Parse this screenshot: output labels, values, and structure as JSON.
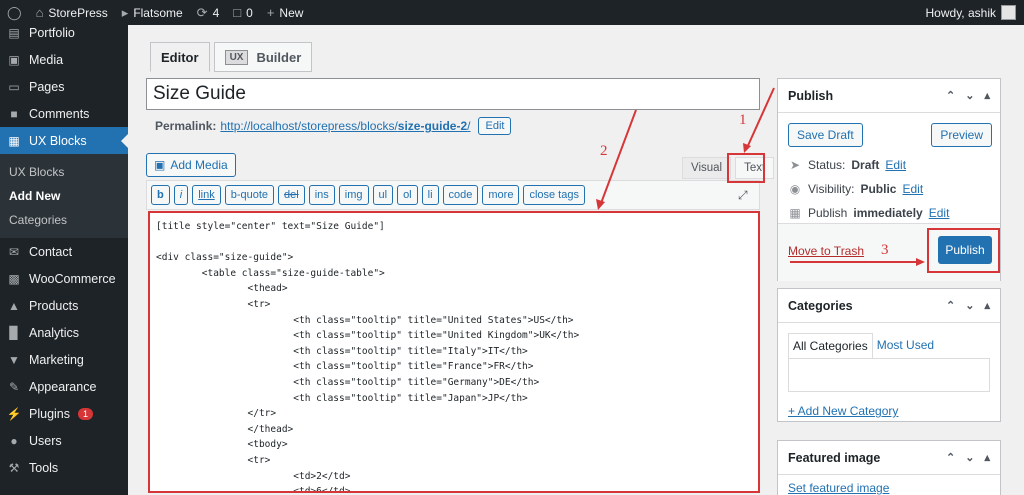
{
  "adminbar": {
    "site_name": "StorePress",
    "theme": "Flatsome",
    "updates": "4",
    "comments": "0",
    "new": "New",
    "howdy": "Howdy, ashik"
  },
  "sidebar": {
    "items": [
      {
        "label": "Portfolio"
      },
      {
        "label": "Media"
      },
      {
        "label": "Pages"
      },
      {
        "label": "Comments"
      },
      {
        "label": "UX Blocks"
      }
    ],
    "submenu": [
      "UX Blocks",
      "Add New",
      "Categories"
    ],
    "items2": [
      {
        "label": "Contact"
      },
      {
        "label": "WooCommerce"
      },
      {
        "label": "Products"
      },
      {
        "label": "Analytics"
      },
      {
        "label": "Marketing"
      },
      {
        "label": "Appearance"
      },
      {
        "label": "Plugins"
      },
      {
        "label": "Users"
      },
      {
        "label": "Tools"
      }
    ],
    "plugins_badge": "1"
  },
  "editor": {
    "tab_editor": "Editor",
    "tab_builder_logo": "UX",
    "tab_builder": "Builder",
    "title_value": "Size Guide",
    "permalink_label": "Permalink:",
    "permalink_base": "http://localhost/storepress/blocks/",
    "permalink_slug": "size-guide-2",
    "permalink_tail": "/",
    "edit_btn": "Edit",
    "add_media": "Add Media",
    "tab_visual": "Visual",
    "tab_text": "Text",
    "quicktags": [
      "b",
      "i",
      "link",
      "b-quote",
      "del",
      "ins",
      "img",
      "ul",
      "ol",
      "li",
      "code",
      "more",
      "close tags"
    ],
    "code": "[title style=\"center\" text=\"Size Guide\"]\n\n<div class=\"size-guide\">\n        <table class=\"size-guide-table\">\n                <thead>\n                <tr>\n                        <th class=\"tooltip\" title=\"United States\">US</th>\n                        <th class=\"tooltip\" title=\"United Kingdom\">UK</th>\n                        <th class=\"tooltip\" title=\"Italy\">IT</th>\n                        <th class=\"tooltip\" title=\"France\">FR</th>\n                        <th class=\"tooltip\" title=\"Germany\">DE</th>\n                        <th class=\"tooltip\" title=\"Japan\">JP</th>\n                </tr>\n                </thead>\n                <tbody>\n                <tr>\n                        <td>2</td>\n                        <td>6</td>"
  },
  "publish": {
    "title": "Publish",
    "save_draft": "Save Draft",
    "preview": "Preview",
    "status_label": "Status:",
    "status_value": "Draft",
    "visibility_label": "Visibility:",
    "visibility_value": "Public",
    "publish_label": "Publish",
    "publish_value": "immediately",
    "edit": "Edit",
    "trash": "Move to Trash",
    "publish_btn": "Publish"
  },
  "categories": {
    "title": "Categories",
    "tab_all": "All Categories",
    "tab_used": "Most Used",
    "add_new": "+ Add New Category"
  },
  "featured": {
    "title": "Featured image",
    "set": "Set featured image"
  },
  "annotations": {
    "one": "1",
    "two": "2",
    "three": "3",
    "color": "#d63638"
  }
}
